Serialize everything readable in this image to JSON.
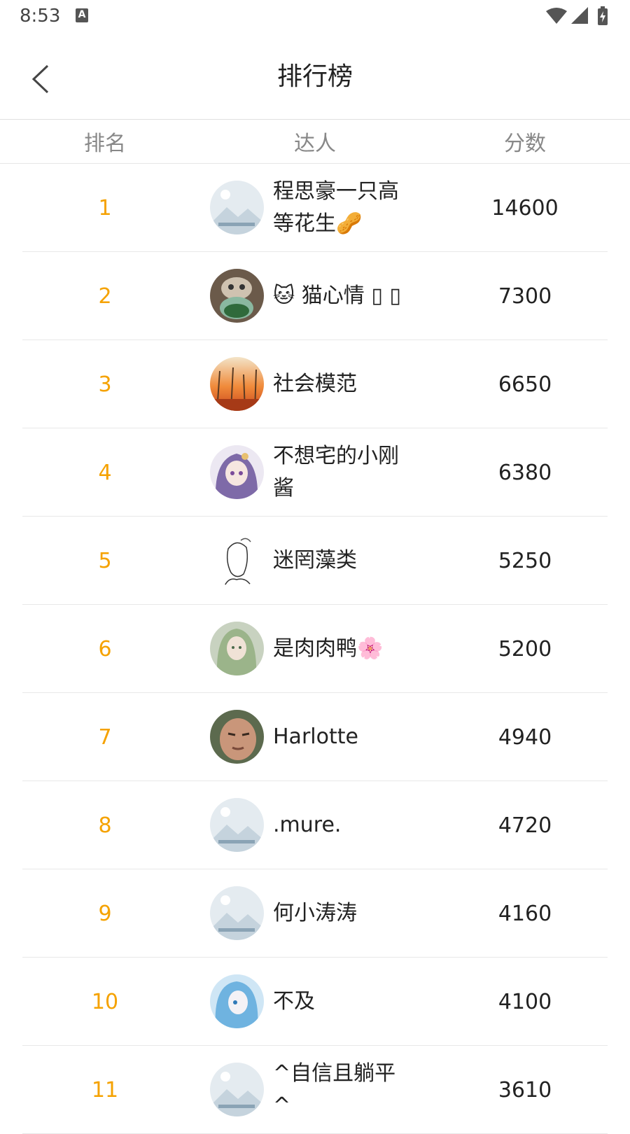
{
  "status": {
    "time": "8:53",
    "notification_icon_label": "A"
  },
  "toolbar": {
    "title": "排行榜",
    "back_icon": "back-arrow-icon"
  },
  "table": {
    "headers": {
      "rank": "排名",
      "user": "达人",
      "score": "分数"
    },
    "rows": [
      {
        "rank": "1",
        "name": "程思豪一只高等花生🥜",
        "score": "14600",
        "avatar": "placeholder"
      },
      {
        "rank": "2",
        "name": "🐱 猫心情 ▯ ▯",
        "score": "7300",
        "avatar": "cat"
      },
      {
        "rank": "3",
        "name": "社会模范",
        "score": "6650",
        "avatar": "sunset"
      },
      {
        "rank": "4",
        "name": "不想宅的小刚酱",
        "score": "6380",
        "avatar": "anime-purple"
      },
      {
        "rank": "5",
        "name": "迷罔藻类",
        "score": "5250",
        "avatar": "sketch"
      },
      {
        "rank": "6",
        "name": "是肉肉鸭🌸",
        "score": "5200",
        "avatar": "green-girl"
      },
      {
        "rank": "7",
        "name": "Harlotte",
        "score": "4940",
        "avatar": "face"
      },
      {
        "rank": "8",
        "name": ".mure.",
        "score": "4720",
        "avatar": "placeholder"
      },
      {
        "rank": "9",
        "name": "何小涛涛",
        "score": "4160",
        "avatar": "placeholder"
      },
      {
        "rank": "10",
        "name": "不及",
        "score": "4100",
        "avatar": "anime-blue"
      },
      {
        "rank": "11",
        "name": "^自信且躺平^",
        "score": "3610",
        "avatar": "placeholder"
      }
    ]
  },
  "colors": {
    "rank": "#f5a200",
    "text": "#222222",
    "header_text": "#888888",
    "divider": "#e8e8e8"
  }
}
